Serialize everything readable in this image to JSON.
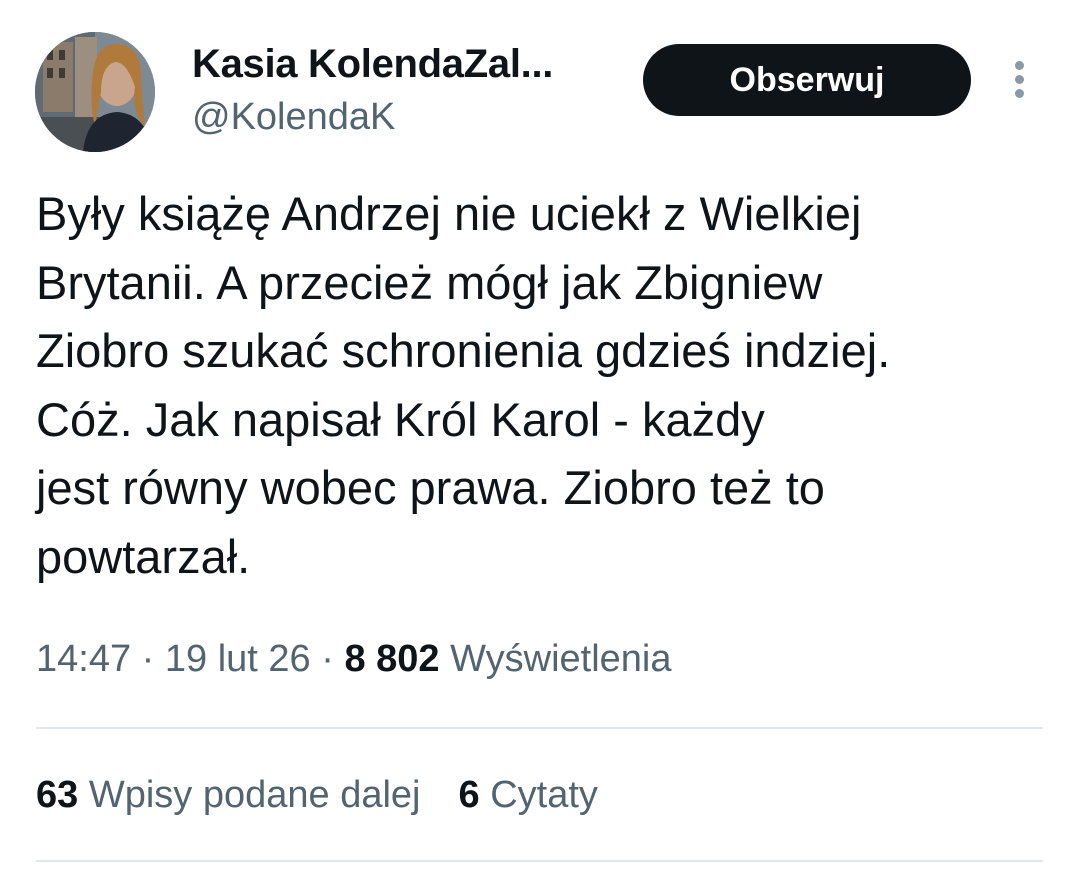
{
  "author": {
    "display_name": "Kasia KolendaZal...",
    "handle": "@KolendaK"
  },
  "follow_button": {
    "label": "Obserwuj"
  },
  "more_icon": "vertical-ellipsis",
  "tweet": {
    "lines": [
      "Były książę Andrzej nie uciekł z Wielkiej",
      "Brytanii. A przecież mógł jak Zbigniew",
      "Ziobro szukać schronienia gdzieś indziej.",
      "Cóż. Jak napisał Król Karol - każdy",
      "jest równy wobec prawa. Ziobro też to",
      "powtarzał."
    ]
  },
  "meta": {
    "time": "14:47",
    "separator": " · ",
    "date": "19 lut 26",
    "views_count": "8 802",
    "views_label": "Wyświetlenia"
  },
  "stats": {
    "reposts_count": "63",
    "reposts_label": "Wpisy podane dalej",
    "quotes_count": "6",
    "quotes_label": "Cytaty"
  },
  "colors": {
    "text": "#0f1419",
    "secondary": "#536471",
    "button_bg": "#0f1419",
    "divider": "#e1e7eb"
  }
}
